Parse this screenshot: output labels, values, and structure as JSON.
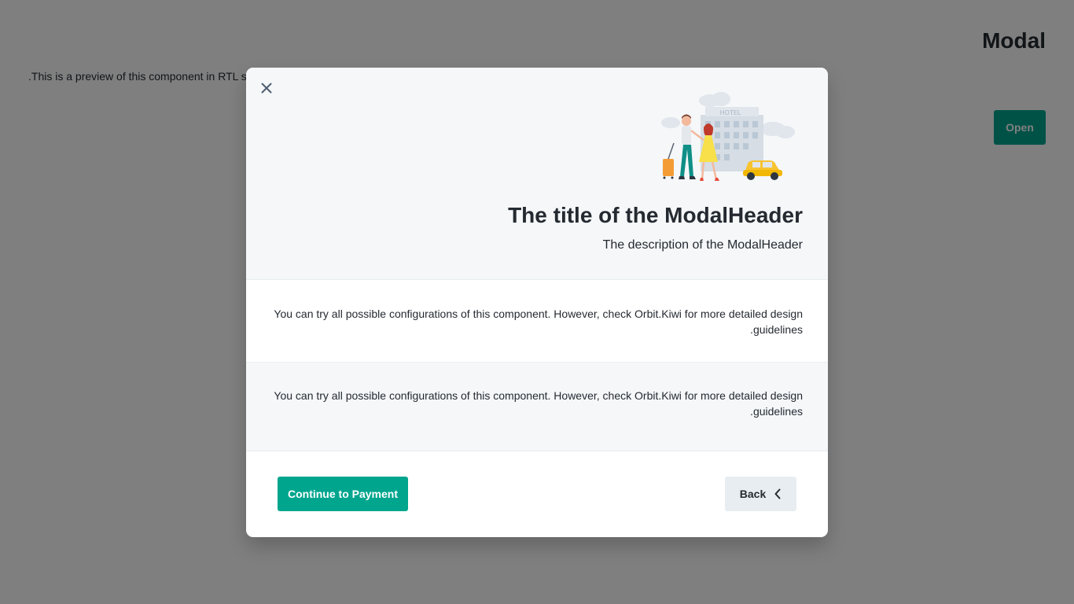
{
  "page": {
    "title": "Modal",
    "description": ".This is a preview of this component in RTL se",
    "open_label": "Open"
  },
  "modal": {
    "close_icon": "close-icon",
    "illustration": "hotel-couple-illustration",
    "header": {
      "title": "The title of the ModalHeader",
      "description": "The description of the ModalHeader"
    },
    "sections": [
      {
        "text": "You can try all possible configurations of this component. However, check Orbit.Kiwi for more detailed design guidelines."
      },
      {
        "text": "You can try all possible configurations of this component. However, check Orbit.Kiwi for more detailed design guidelines."
      }
    ],
    "footer": {
      "continue_label": "Continue to Payment",
      "back_label": "Back",
      "back_icon": "chevron-left-icon"
    }
  },
  "colors": {
    "primary": "#00a58e",
    "overlay": "rgba(0,0,0,0.5)",
    "header_bg": "#f5f7f9",
    "secondary_button": "#e8edf1",
    "ink": "#252a31"
  }
}
